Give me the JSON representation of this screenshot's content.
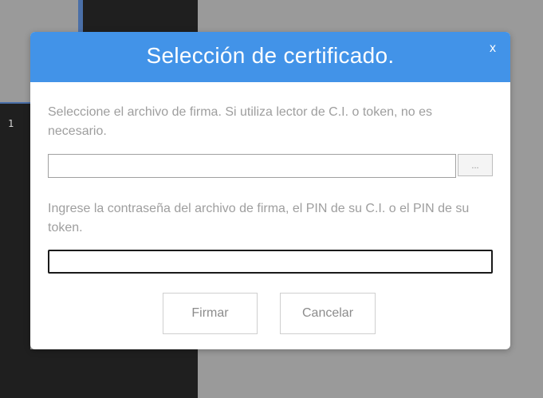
{
  "background": {
    "line_number": "1"
  },
  "dialog": {
    "title": "Selección de certificado.",
    "close_label": "x",
    "file_instruction": "Seleccione el archivo de firma. Si utiliza lector de C.I. o token, no es necesario.",
    "file_value": "",
    "browse_label": "...",
    "password_instruction": "Ingrese la contraseña del archivo de firma, el PIN de su C.I. o el PIN de su token.",
    "password_value": "",
    "sign_label": "Firmar",
    "cancel_label": "Cancelar",
    "colors": {
      "header": "#4293e8",
      "text_muted": "#9e9e9e"
    }
  }
}
